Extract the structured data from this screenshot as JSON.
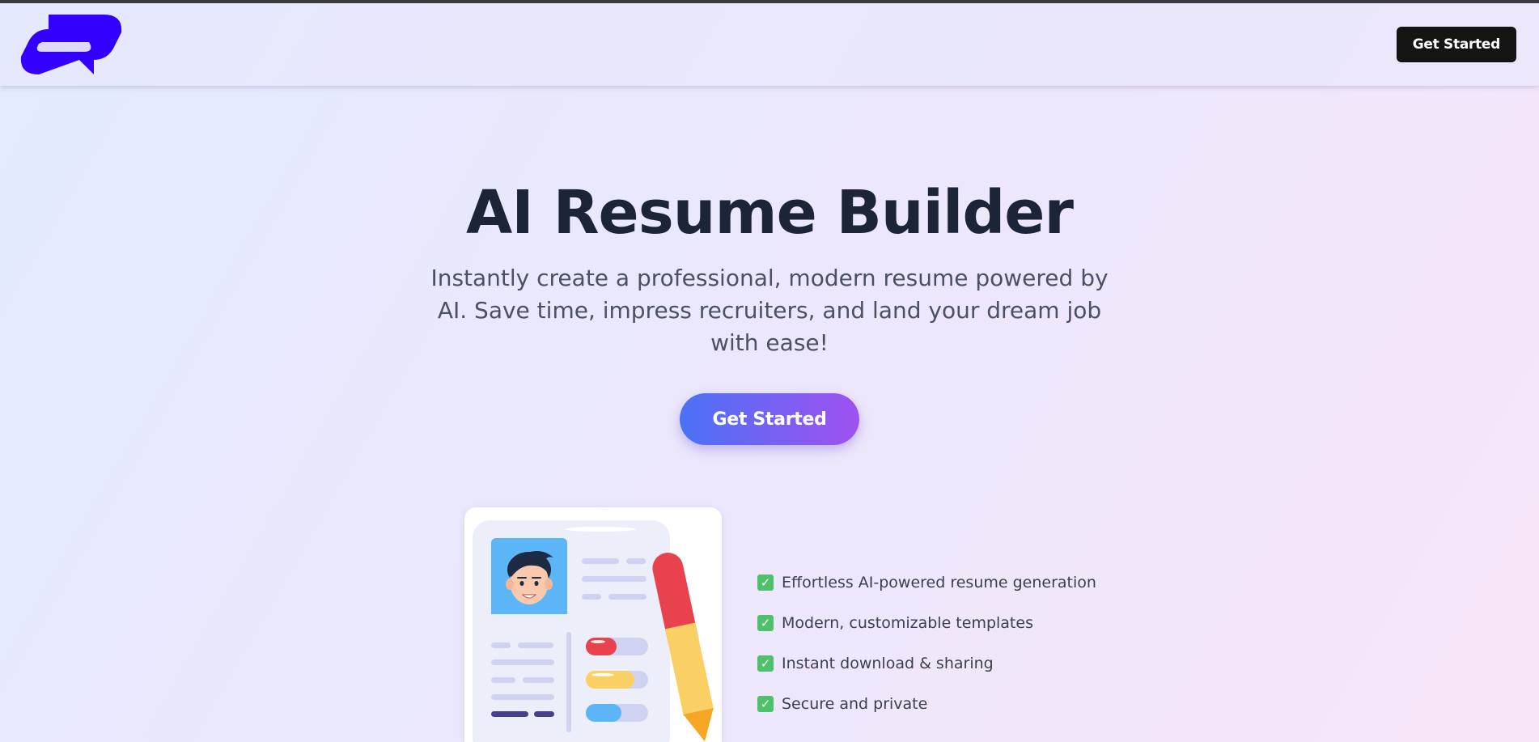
{
  "colors": {
    "brand": "#3300ff",
    "nav_cta_bg": "#141414",
    "hero_gradient_start": "#4a72f5",
    "hero_gradient_end": "#a051f0",
    "check": "#4fc06b",
    "title": "#1c2437"
  },
  "navbar": {
    "logo_icon": "brand-logo",
    "cta_label": "Get Started"
  },
  "hero": {
    "title": "AI Resume Builder",
    "subtitle": "Instantly create a professional, modern resume powered by AI. Save time, impress recruiters, and land your dream job with ease!",
    "cta_label": "Get Started"
  },
  "illustration": {
    "icon": "resume-with-pen-illustration"
  },
  "features": [
    {
      "icon": "check-icon",
      "label": "Effortless AI-powered resume generation"
    },
    {
      "icon": "check-icon",
      "label": "Modern, customizable templates"
    },
    {
      "icon": "check-icon",
      "label": "Instant download & sharing"
    },
    {
      "icon": "check-icon",
      "label": "Secure and private"
    }
  ]
}
